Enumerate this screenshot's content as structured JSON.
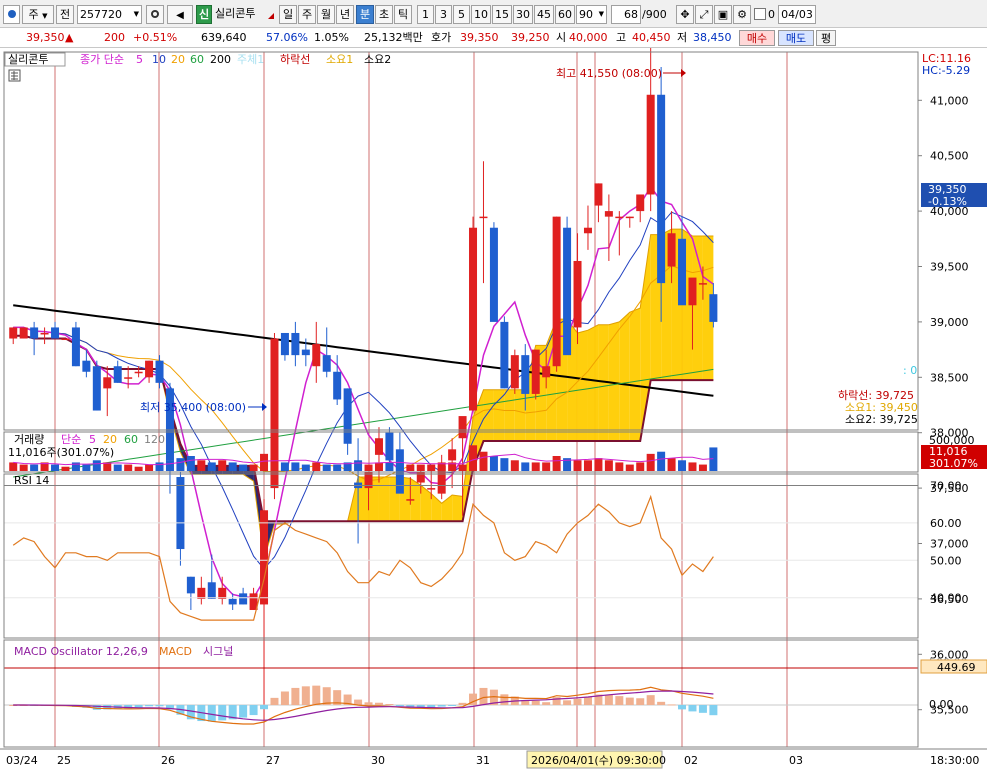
{
  "toolbar": {
    "main_dot": "",
    "type_select": "주",
    "type_arrow": "▼",
    "prev_label": "전",
    "code": "257720",
    "code_arrow": "▼",
    "shin_badge": "신",
    "stock_name": "실리콘투",
    "periods": [
      "일",
      "주",
      "월",
      "년",
      "분",
      "초",
      "틱"
    ],
    "active_period": "분",
    "intervals": [
      "1",
      "3",
      "5",
      "10",
      "15",
      "30",
      "45",
      "60"
    ],
    "interval_value": "90",
    "interval_arrow": "▼",
    "count": "68",
    "count_total": "/900",
    "check_value": "0",
    "date": "04/03"
  },
  "quote": {
    "price": "39,350",
    "change_arrow": "▲",
    "change": "200",
    "change_pct": "+0.51%",
    "volume": "639,640",
    "ratio": "57.06%",
    "turnover": "1.05%",
    "amount": "25,132백만",
    "ask_label": "호가",
    "ask1": "39,350",
    "ask2": "39,250",
    "open_label": "시",
    "open": "40,000",
    "high_label": "고",
    "high": "40,450",
    "low_label": "저",
    "low": "38,450",
    "buy_label": "매수",
    "sell_label": "매도",
    "avg_label": "평"
  },
  "price_panel": {
    "legend": {
      "name": "실리콘투",
      "ma_label": "종가 단순",
      "ma_periods": [
        "5",
        "10",
        "20",
        "60",
        "200"
      ],
      "ma_colors": [
        "#d020d0",
        "#2040c0",
        "#f0a000",
        "#20a040",
        "#000000"
      ],
      "faint_item": "주체1",
      "item_lower": "하락선",
      "item_sup1": "소요1",
      "item_sup2": "소요2"
    },
    "lc": "LC:11.16",
    "hc": "HC:-5.29",
    "axis_ticks": [
      "41,000",
      "40,500",
      "40,000",
      "39,500",
      "39,000",
      "38,500",
      "38,000",
      "37,500",
      "37,000",
      "36,500",
      "36,000",
      "35,500"
    ],
    "current_price": "39,350",
    "current_pct": "-0.13%",
    "high_note": "최고 41,550 (08:00)",
    "low_note": "최저 35,400 (08:00)",
    "zero_note": ": 0",
    "lower_line": "하락선: 39,725",
    "support1": "소요1: 39,450",
    "support2": "소요2: 39,725"
  },
  "volume_panel": {
    "title": "거래량",
    "ma_label": "단순",
    "ma_periods": [
      "5",
      "20",
      "60",
      "120"
    ],
    "current": "11,016주(301.07%)",
    "axis_top": "500,000",
    "badge_value": "11,016",
    "badge_pct": "301.07%"
  },
  "rsi_panel": {
    "title": "RSI 14",
    "ticks": [
      "70.00",
      "60.00",
      "50.00",
      "40.00"
    ]
  },
  "macd_panel": {
    "title": "MACD Oscillator 12,26,9",
    "macd_label": "MACD",
    "signal_label": "시그널",
    "axis_top": "500.00",
    "badge": "449.69",
    "zero_tick": "0.00"
  },
  "xaxis": {
    "labels": [
      "03/24",
      "25",
      "26",
      "27",
      "30",
      "31",
      "02",
      "03"
    ],
    "cursor_time": "2026/04/01(수) 09:30:00",
    "right_time": "18:30:00"
  },
  "chart_data": {
    "type": "candlestick",
    "candles": [
      [
        38850,
        38950,
        38800,
        38950
      ],
      [
        38850,
        38950,
        38850,
        38950
      ],
      [
        38950,
        39000,
        38700,
        38850
      ],
      [
        38900,
        38950,
        38800,
        38900
      ],
      [
        38950,
        39000,
        38850,
        38850
      ],
      [
        38850,
        38850,
        38850,
        38850
      ],
      [
        38950,
        39000,
        38600,
        38600
      ],
      [
        38650,
        38750,
        38500,
        38550
      ],
      [
        38600,
        38650,
        38200,
        38200
      ],
      [
        38400,
        38600,
        38150,
        38500
      ],
      [
        38600,
        38650,
        38450,
        38450
      ],
      [
        38500,
        38600,
        38400,
        38500
      ],
      [
        38550,
        38600,
        38500,
        38550
      ],
      [
        38500,
        38650,
        38450,
        38650
      ],
      [
        38650,
        38700,
        38400,
        38450
      ],
      [
        38400,
        38450,
        37450,
        37750
      ],
      [
        37600,
        37650,
        36800,
        36950
      ],
      [
        36700,
        36700,
        36400,
        36550
      ],
      [
        36500,
        36700,
        36450,
        36600
      ],
      [
        36650,
        36900,
        36500,
        36500
      ],
      [
        36500,
        36700,
        36450,
        36600
      ],
      [
        36500,
        36550,
        36400,
        36450
      ],
      [
        36550,
        36600,
        36450,
        36450
      ],
      [
        36400,
        36600,
        36400,
        36550
      ],
      [
        36450,
        37400,
        35400,
        37300
      ],
      [
        37500,
        38900,
        37400,
        38850
      ],
      [
        38900,
        38900,
        38650,
        38700
      ],
      [
        38900,
        39000,
        38600,
        38700
      ],
      [
        38750,
        38850,
        38600,
        38700
      ],
      [
        38600,
        39000,
        38450,
        38800
      ],
      [
        38700,
        38950,
        38500,
        38550
      ],
      [
        38550,
        38700,
        38250,
        38300
      ],
      [
        38400,
        38400,
        37800,
        37900
      ],
      [
        37550,
        37950,
        37000,
        37500
      ],
      [
        37500,
        37650,
        37300,
        37650
      ],
      [
        37800,
        38050,
        37550,
        37950
      ],
      [
        38000,
        38050,
        37700,
        37750
      ],
      [
        37850,
        38000,
        37500,
        37450
      ],
      [
        37400,
        37600,
        37350,
        37400
      ],
      [
        37550,
        37700,
        37450,
        37650
      ],
      [
        37500,
        37700,
        37400,
        37500
      ],
      [
        37450,
        37800,
        37400,
        37700
      ],
      [
        37750,
        37950,
        37500,
        37850
      ],
      [
        37950,
        38050,
        37250,
        38150
      ],
      [
        38200,
        39950,
        38200,
        39850
      ],
      [
        39950,
        40450,
        39350,
        39950
      ],
      [
        39850,
        39900,
        39150,
        39000
      ],
      [
        39000,
        39050,
        38400,
        38400
      ],
      [
        38400,
        38750,
        38350,
        38700
      ],
      [
        38700,
        38800,
        38200,
        38350
      ],
      [
        38350,
        38750,
        38300,
        38750
      ],
      [
        38500,
        38750,
        38400,
        38600
      ],
      [
        38600,
        39950,
        38550,
        39950
      ],
      [
        39850,
        39950,
        38950,
        38700
      ],
      [
        38950,
        39800,
        38800,
        39550
      ],
      [
        39800,
        40050,
        39650,
        39850
      ],
      [
        40050,
        40250,
        39900,
        40250
      ],
      [
        39950,
        40150,
        39550,
        40000
      ],
      [
        39950,
        40000,
        39600,
        39950
      ],
      [
        39950,
        39950,
        39850,
        39950
      ],
      [
        40000,
        40100,
        39900,
        40150
      ],
      [
        40150,
        41550,
        40000,
        41050
      ],
      [
        41050,
        41300,
        39000,
        39350
      ],
      [
        39500,
        40000,
        39350,
        39800
      ],
      [
        39750,
        39950,
        39200,
        39150
      ],
      [
        39150,
        39350,
        38750,
        39400
      ],
      [
        39350,
        39500,
        39200,
        39350
      ],
      [
        39250,
        39350,
        38950,
        39000
      ]
    ],
    "volumes": [
      4,
      3,
      3,
      4,
      3,
      2,
      4,
      3,
      5,
      4,
      3,
      3,
      2,
      3,
      4,
      5,
      6,
      7,
      5,
      4,
      5,
      4,
      3,
      3,
      8,
      6,
      4,
      4,
      3,
      4,
      3,
      3,
      4,
      5,
      3,
      4,
      4,
      4,
      3,
      3,
      3,
      4,
      4,
      3,
      12,
      9,
      7,
      6,
      5,
      4,
      4,
      4,
      7,
      6,
      5,
      5,
      6,
      5,
      4,
      3,
      4,
      8,
      9,
      6,
      5,
      4,
      3,
      11
    ],
    "rsi": [
      54,
      56,
      55,
      51,
      48,
      52,
      52,
      51,
      51,
      50,
      52,
      52,
      52,
      52,
      51,
      39,
      36,
      35,
      34,
      34,
      34,
      34,
      34,
      34,
      45,
      58,
      60,
      58,
      57,
      56,
      55,
      52,
      47,
      44,
      44,
      47,
      46,
      50,
      48,
      44,
      43,
      45,
      48,
      52,
      65,
      62,
      60,
      52,
      50,
      51,
      55,
      54,
      52,
      57,
      60,
      62,
      65,
      63,
      60,
      59,
      60,
      67,
      56,
      53,
      46,
      49,
      47,
      51
    ],
    "x_labels": [
      "03/24",
      "25",
      "26",
      "27",
      "30",
      "31",
      "02",
      "03"
    ]
  }
}
